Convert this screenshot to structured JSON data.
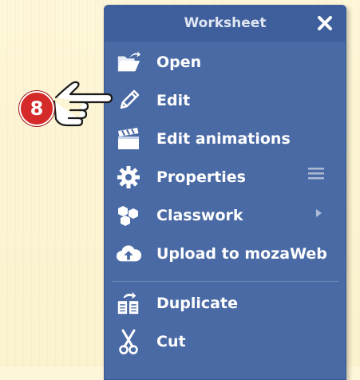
{
  "panel": {
    "title": "Worksheet",
    "close_icon": "close-icon"
  },
  "menu_items": [
    {
      "label": "Open",
      "icon": "folder-open-icon"
    },
    {
      "label": "Edit",
      "icon": "pencil-icon"
    },
    {
      "label": "Edit animations",
      "icon": "clapperboard-icon"
    },
    {
      "label": "Properties",
      "icon": "gear-icon",
      "trailing_icon": "hamburger-menu-icon"
    },
    {
      "label": "Classwork",
      "icon": "hexagons-icon",
      "trailing_icon": "submenu-arrow-icon"
    },
    {
      "label": "Upload to mozaWeb",
      "icon": "cloud-upload-icon"
    },
    {
      "label": "Duplicate",
      "icon": "duplicate-icon"
    },
    {
      "label": "Cut",
      "icon": "scissors-icon"
    }
  ],
  "annotation": {
    "step_number": "8",
    "pointer_icon": "pointing-hand-icon"
  },
  "colors": {
    "menu_bg": "#4a6aa5",
    "header_bg": "#3f5f9c",
    "badge_red": "#d42a2a",
    "page_bg": "#fdf6d8"
  }
}
